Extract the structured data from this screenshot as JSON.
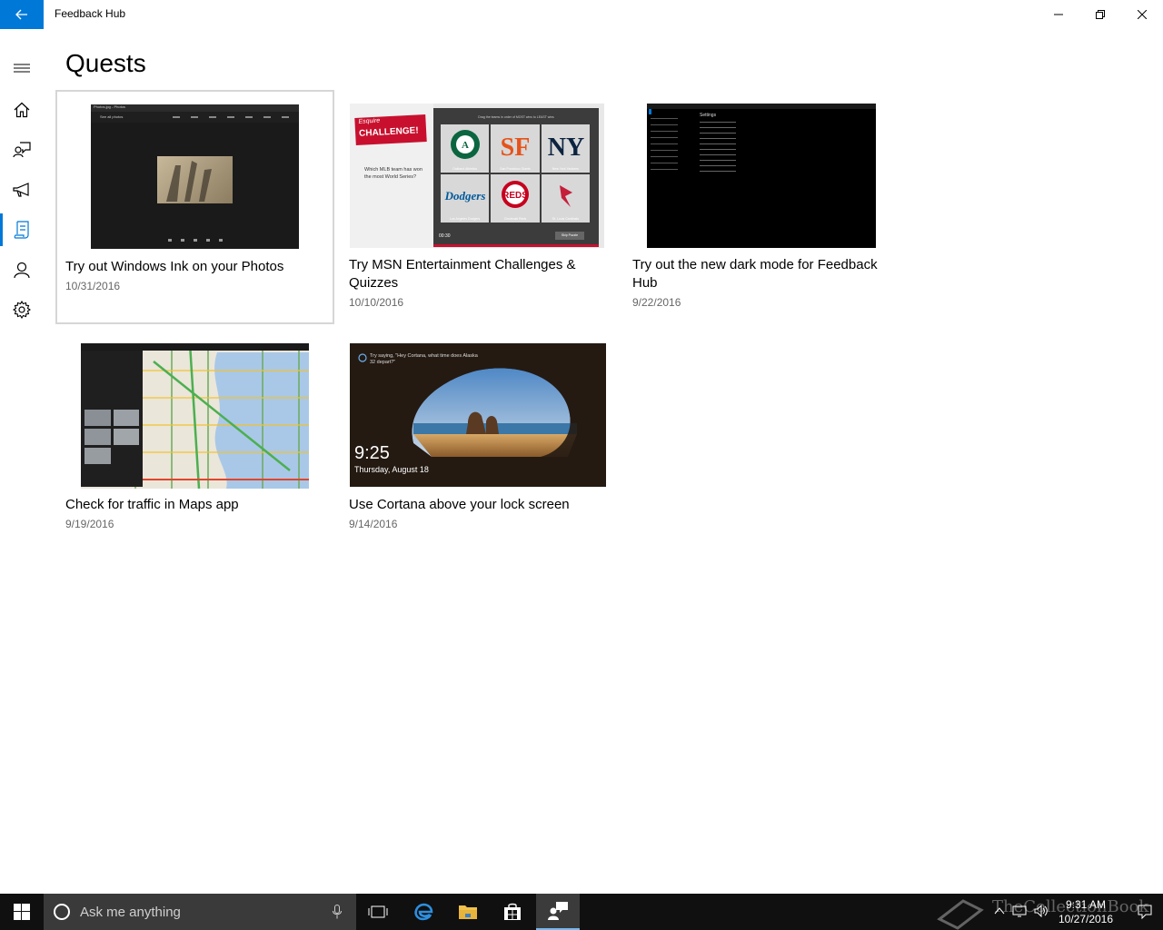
{
  "window": {
    "title": "Feedback Hub"
  },
  "page": {
    "title": "Quests"
  },
  "nav": {
    "items": [
      {
        "icon": "hamburger-icon"
      },
      {
        "icon": "home-icon"
      },
      {
        "icon": "feedback-icon"
      },
      {
        "icon": "announcements-icon"
      },
      {
        "icon": "quests-icon"
      },
      {
        "icon": "profile-icon"
      },
      {
        "icon": "settings-icon"
      }
    ],
    "active_index": 4
  },
  "quests": [
    {
      "title": "Try out Windows Ink on your Photos",
      "date": "10/31/2016"
    },
    {
      "title": "Try MSN Entertainment Challenges & Quizzes",
      "date": "10/10/2016"
    },
    {
      "title": "Try out the new dark mode for Feedback Hub",
      "date": "9/22/2016"
    },
    {
      "title": "Check for traffic in Maps app",
      "date": "9/19/2016"
    },
    {
      "title": "Use Cortana above your lock screen",
      "date": "9/14/2016"
    }
  ],
  "thumbs": {
    "photos": {
      "toolbar_title": "Photos.jpg - Photos",
      "back_label": "See all photos"
    },
    "msn": {
      "brand": "Esquire",
      "badge": "CHALLENGE!",
      "question": "Which MLB team has won the most World Series?",
      "instruction": "Drag the teams in order of MOST wins to LEAST wins",
      "timer": "00:30",
      "teams": [
        "Oakland Athletics",
        "San Francisco Giants",
        "New York Yankees",
        "Los Angeles Dodgers",
        "Cincinnati Reds",
        "St. Louis Cardinals"
      ],
      "button": "Skip Puzzle"
    },
    "dark": {
      "heading": "Settings"
    },
    "cortana": {
      "prompt": "Try saying, \"Hey Cortana, what time does Alaska 32 depart?\"",
      "time": "9:25",
      "date": "Thursday, August 18"
    }
  },
  "taskbar": {
    "search_placeholder": "Ask me anything",
    "time": "9:31 AM",
    "date": "10/27/2016",
    "watermark": "TheCollectionBook"
  },
  "colors": {
    "accent": "#0078d7",
    "taskbar": "#101010"
  }
}
